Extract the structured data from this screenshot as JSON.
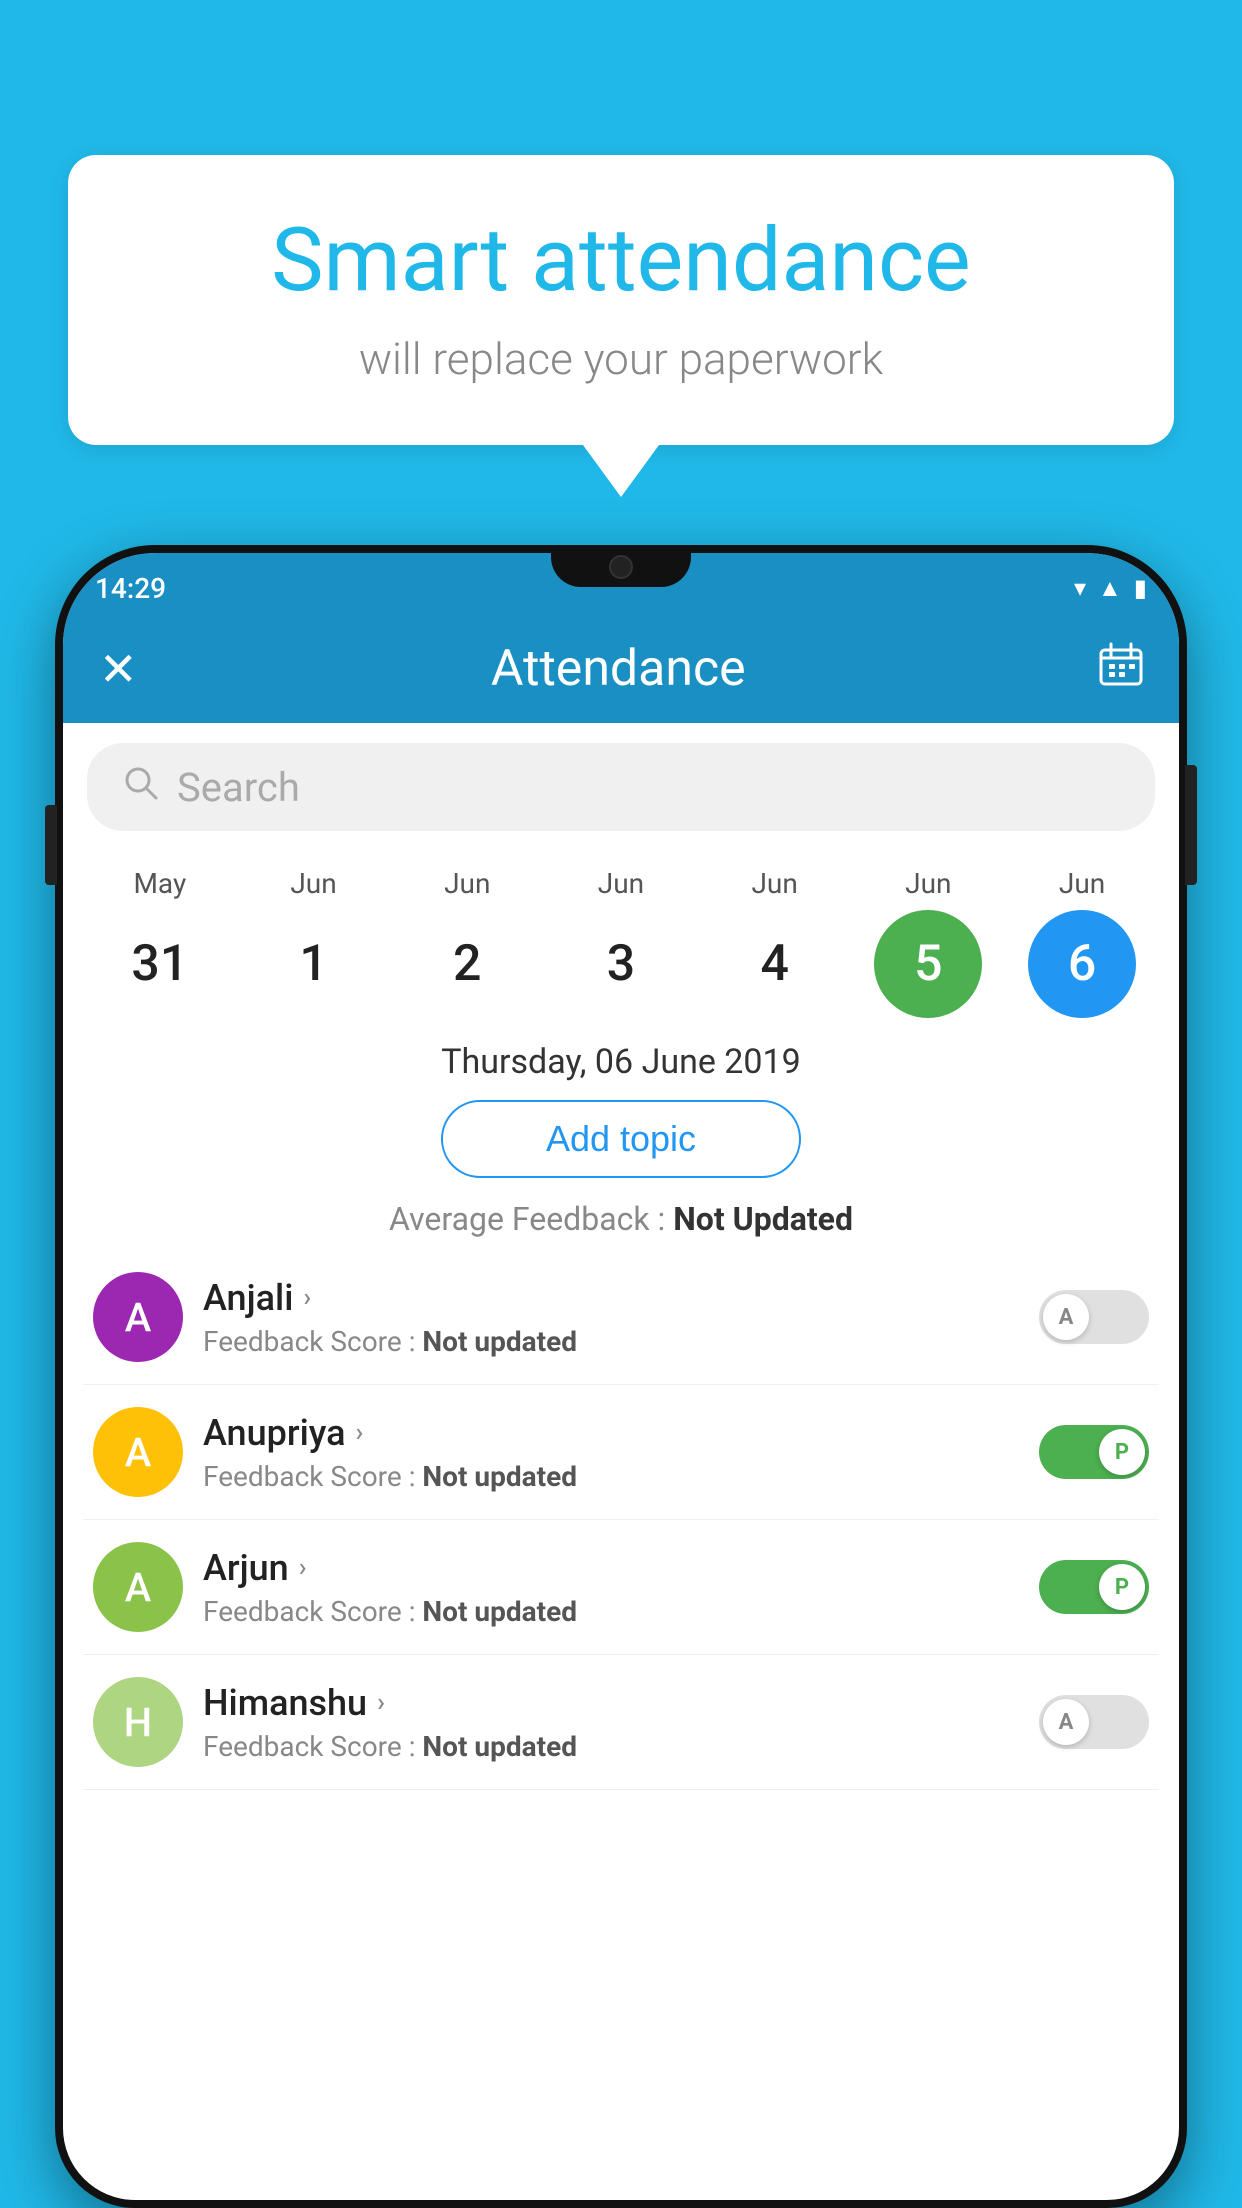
{
  "background": {
    "color": "#20b8e8"
  },
  "speech_bubble": {
    "title": "Smart attendance",
    "subtitle": "will replace your paperwork"
  },
  "status_bar": {
    "time": "14:29",
    "icons": [
      "wifi",
      "signal",
      "battery"
    ]
  },
  "app_header": {
    "close_label": "✕",
    "title": "Attendance",
    "calendar_icon": "📅"
  },
  "search": {
    "placeholder": "Search"
  },
  "calendar": {
    "days": [
      {
        "month": "May",
        "day": "31",
        "style": "normal"
      },
      {
        "month": "Jun",
        "day": "1",
        "style": "normal"
      },
      {
        "month": "Jun",
        "day": "2",
        "style": "normal"
      },
      {
        "month": "Jun",
        "day": "3",
        "style": "normal"
      },
      {
        "month": "Jun",
        "day": "4",
        "style": "normal"
      },
      {
        "month": "Jun",
        "day": "5",
        "style": "today"
      },
      {
        "month": "Jun",
        "day": "6",
        "style": "selected"
      }
    ]
  },
  "selected_date": "Thursday, 06 June 2019",
  "add_topic_button": "Add topic",
  "avg_feedback": {
    "label": "Average Feedback : ",
    "value": "Not Updated"
  },
  "students": [
    {
      "name": "Anjali",
      "avatar_letter": "A",
      "avatar_color": "#9c27b0",
      "feedback_label": "Feedback Score : ",
      "feedback_value": "Not updated",
      "toggle": "off",
      "toggle_letter": "A"
    },
    {
      "name": "Anupriya",
      "avatar_letter": "A",
      "avatar_color": "#ffc107",
      "feedback_label": "Feedback Score : ",
      "feedback_value": "Not updated",
      "toggle": "on",
      "toggle_letter": "P"
    },
    {
      "name": "Arjun",
      "avatar_letter": "A",
      "avatar_color": "#8bc34a",
      "feedback_label": "Feedback Score : ",
      "feedback_value": "Not updated",
      "toggle": "on",
      "toggle_letter": "P"
    },
    {
      "name": "Himanshu",
      "avatar_letter": "H",
      "avatar_color": "#aed581",
      "feedback_label": "Feedback Score : ",
      "feedback_value": "Not updated",
      "toggle": "off",
      "toggle_letter": "A"
    }
  ]
}
